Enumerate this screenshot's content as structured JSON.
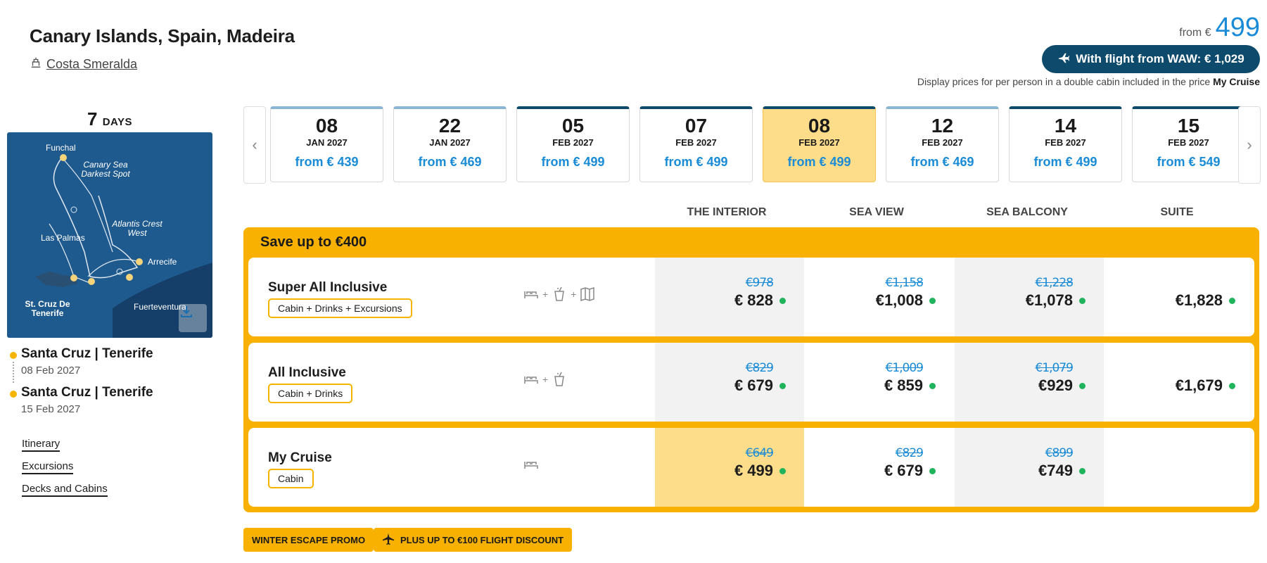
{
  "header": {
    "title": "Canary Islands, Spain, Madeira",
    "ship": "Costa Smeralda",
    "price_from_label": "from €",
    "price_from_value": "499",
    "flight_button": "With flight from WAW: € 1,029",
    "price_note": "Display prices for per person in a double cabin included in the price",
    "price_note_bold": "My Cruise"
  },
  "left": {
    "days_number": "7",
    "days_label": "DAYS",
    "map_labels": {
      "funchal": "Funchal",
      "canary_sea": "Canary Sea Darkest Spot",
      "atlantis": "Atlantis Crest West",
      "las_palmas": "Las Palmas",
      "arrecife": "Arrecife",
      "st_cruz": "St. Cruz De Tenerife",
      "fuerteventura": "Fuerteventura"
    },
    "route": [
      {
        "port": "Santa Cruz | Tenerife",
        "date": "08 Feb 2027"
      },
      {
        "port": "Santa Cruz | Tenerife",
        "date": "15 Feb 2027"
      }
    ],
    "links": [
      "Itinerary",
      "Excursions",
      "Decks and Cabins"
    ]
  },
  "dates": [
    {
      "day": "08",
      "month": "JAN 2027",
      "price": "from € 439"
    },
    {
      "day": "22",
      "month": "JAN 2027",
      "price": "from € 469"
    },
    {
      "day": "05",
      "month": "FEB 2027",
      "price": "from € 499"
    },
    {
      "day": "07",
      "month": "FEB 2027",
      "price": "from € 499"
    },
    {
      "day": "08",
      "month": "FEB 2027",
      "price": "from € 499"
    },
    {
      "day": "12",
      "month": "FEB 2027",
      "price": "from € 469"
    },
    {
      "day": "14",
      "month": "FEB 2027",
      "price": "from € 499"
    },
    {
      "day": "15",
      "month": "FEB 2027",
      "price": "from € 549"
    }
  ],
  "cabins": [
    "THE INTERIOR",
    "SEA VIEW",
    "SEA BALCONY",
    "SUITE"
  ],
  "offers": {
    "save_label": "Save up to €400",
    "packages": [
      {
        "name": "Super All Inclusive",
        "tag": "Cabin + Drinks + Excursions",
        "prices": [
          {
            "old": "€978",
            "now": "€ 828"
          },
          {
            "old": "€1,158",
            "now": "€1,008"
          },
          {
            "old": "€1,228",
            "now": "€1,078"
          },
          {
            "old": "",
            "now": "€1,828"
          }
        ]
      },
      {
        "name": "All Inclusive",
        "tag": "Cabin + Drinks",
        "prices": [
          {
            "old": "€829",
            "now": "€ 679"
          },
          {
            "old": "€1,009",
            "now": "€ 859"
          },
          {
            "old": "€1,079",
            "now": "€929"
          },
          {
            "old": "",
            "now": "€1,679"
          }
        ]
      },
      {
        "name": "My Cruise",
        "tag": "Cabin",
        "prices": [
          {
            "old": "€649",
            "now": "€ 499"
          },
          {
            "old": "€829",
            "now": "€ 679"
          },
          {
            "old": "€899",
            "now": "€749"
          },
          {
            "old": "",
            "now": ""
          }
        ]
      }
    ]
  },
  "promos": [
    "WINTER ESCAPE PROMO",
    "PLUS UP TO €100 FLIGHT DISCOUNT"
  ],
  "colors": {
    "accent_blue": "#1a8bd6",
    "navy": "#0e4a6b",
    "gold": "#f8b100",
    "selected": "#fddd8a",
    "available": "#1fb35b"
  }
}
